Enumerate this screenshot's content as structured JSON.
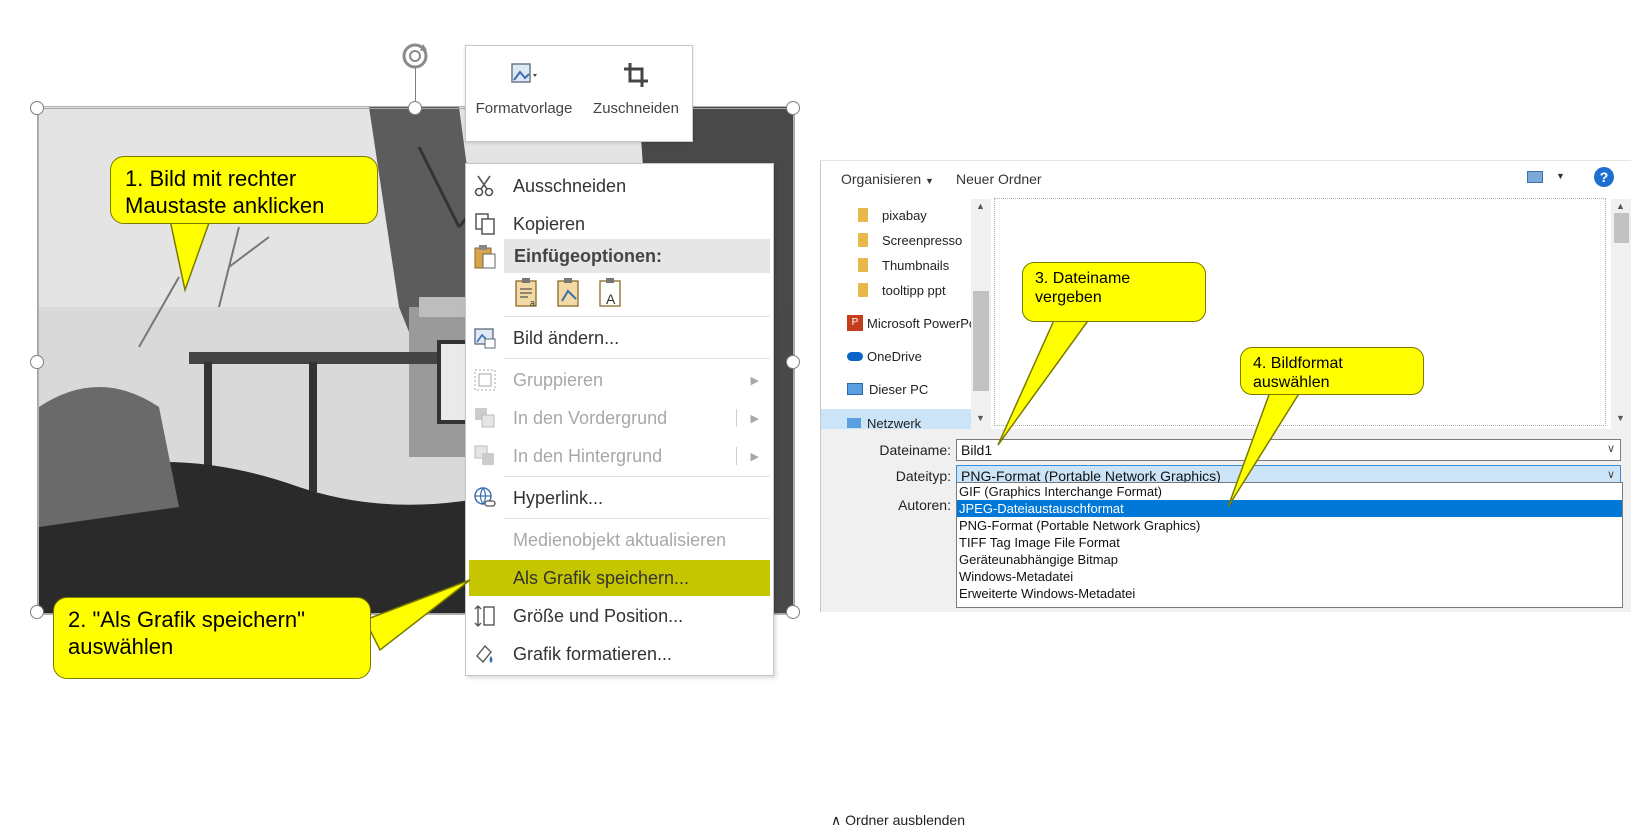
{
  "mini_toolbar": {
    "format_label": "Formatvorlage",
    "crop_label": "Zuschneiden"
  },
  "context_menu": {
    "cut": "Ausschneiden",
    "copy": "Kopieren",
    "paste_header": "Einfügeoptionen:",
    "change_picture": "Bild ändern...",
    "group": "Gruppieren",
    "bring_forward": "In den Vordergrund",
    "send_backward": "In den Hintergrund",
    "hyperlink": "Hyperlink...",
    "update_media": "Medienobjekt aktualisieren",
    "save_as_picture": "Als Grafik speichern...",
    "size_position": "Größe und Position...",
    "format_picture": "Grafik formatieren..."
  },
  "callouts": {
    "step1": "1. Bild mit rechter Maustaste anklicken",
    "step2": "2. \"Als Grafik speichern\" auswählen",
    "step3": "3. Dateiname vergeben",
    "step4": "4. Bildformat auswählen"
  },
  "dialog": {
    "toolbar": {
      "organize": "Organisieren",
      "new_folder": "Neuer Ordner"
    },
    "nav": [
      {
        "label": "pixabay",
        "icon": "folder-icon"
      },
      {
        "label": "Screenpresso",
        "icon": "folder-icon"
      },
      {
        "label": "Thumbnails",
        "icon": "folder-icon"
      },
      {
        "label": "tooltipp ppt",
        "icon": "folder-icon"
      },
      {
        "label": "Microsoft PowerPo",
        "icon": "powerpoint-icon"
      },
      {
        "label": "OneDrive",
        "icon": "cloud-icon"
      },
      {
        "label": "Dieser PC",
        "icon": "computer-icon",
        "selected": true
      },
      {
        "label": "Netzwerk",
        "icon": "network-icon"
      }
    ],
    "filename_label": "Dateiname:",
    "filename_value": "Bild1",
    "filetype_label": "Dateityp:",
    "filetype_value": "PNG-Format (Portable Network Graphics)",
    "authors_label": "Autoren:",
    "filetype_options": [
      "GIF (Graphics Interchange Format)",
      "JPEG-Dateiaustauschformat",
      "PNG-Format (Portable Network Graphics)",
      "TIFF Tag Image File Format",
      "Geräteunabhängige Bitmap",
      "Windows-Metadatei",
      "Erweiterte Windows-Metadatei"
    ],
    "filetype_selected": "JPEG-Dateiaustauschformat",
    "hide_folders": "Ordner ausblenden",
    "help": "?"
  },
  "colors": {
    "callout_fill": "#ffff00",
    "menu_highlight": "#c6c600",
    "list_selection": "#0078d7",
    "field_focus": "#cce4f7"
  }
}
